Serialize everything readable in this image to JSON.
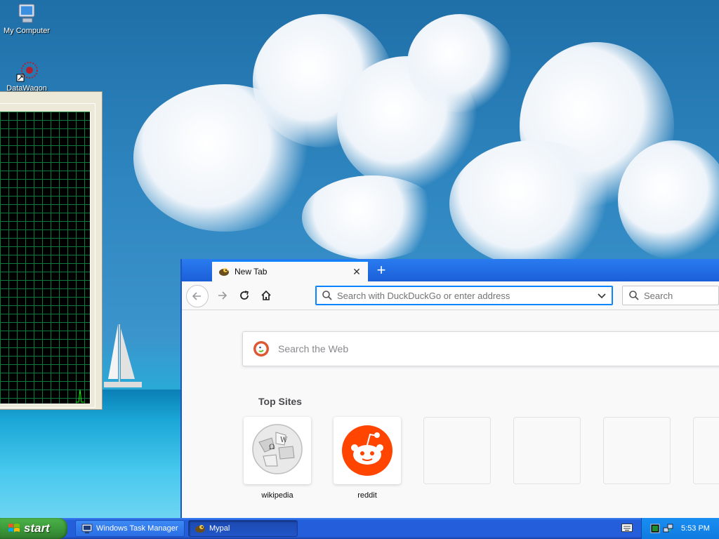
{
  "desktop": {
    "icons": [
      {
        "label": "My Computer",
        "icon": "computer-icon"
      },
      {
        "label": "DataWagon",
        "icon": "datawagon-icon"
      }
    ]
  },
  "browser": {
    "tab_title": "New Tab",
    "url_placeholder": "Search with DuckDuckGo or enter address",
    "search_placeholder": "Search",
    "web_search_placeholder": "Search the Web",
    "top_sites_title": "Top Sites",
    "top_sites": [
      {
        "label": "wikipedia",
        "icon": "wikipedia-icon"
      },
      {
        "label": "reddit",
        "icon": "reddit-icon"
      },
      {
        "label": "",
        "icon": ""
      },
      {
        "label": "",
        "icon": ""
      },
      {
        "label": "",
        "icon": ""
      },
      {
        "label": "",
        "icon": ""
      }
    ]
  },
  "taskbar": {
    "start_label": "start",
    "buttons": [
      {
        "label": "Windows Task Manager",
        "icon": "taskmanager-icon",
        "active": false
      },
      {
        "label": "Mypal",
        "icon": "mypal-icon",
        "active": true
      }
    ],
    "clock": "5:53 PM"
  },
  "colors": {
    "accent": "#0a84ff",
    "taskbar": "#245edb",
    "start": "#3c9a3a",
    "reddit": "#ff4500"
  }
}
